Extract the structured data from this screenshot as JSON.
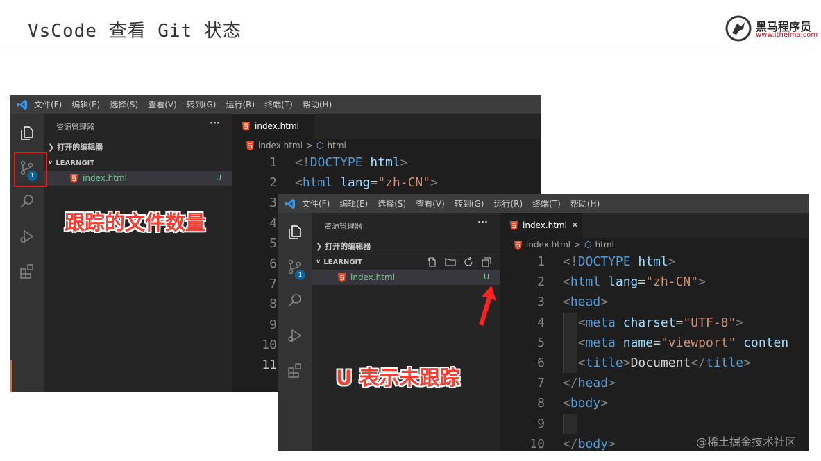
{
  "slide": {
    "title": "VsCode 查看 Git 状态",
    "logo_text": "黑马程序员",
    "logo_url": "www.itheima.com"
  },
  "menu": [
    "文件(F)",
    "编辑(E)",
    "选择(S)",
    "查看(V)",
    "转到(G)",
    "运行(R)",
    "终端(T)",
    "帮助(H)"
  ],
  "explorer": {
    "title": "资源管理器",
    "more": "···",
    "open_editors": "打开的编辑器",
    "folder": "LEARNGIT",
    "file_name": "index.html",
    "file_status": "U"
  },
  "scm_badge": "1",
  "tab": {
    "label": "index.html",
    "close": "✕"
  },
  "breadcrumb": {
    "file": "index.html",
    "sep": ">",
    "symbol": "html"
  },
  "line_numbers": [
    "1",
    "2",
    "3",
    "4",
    "5",
    "6",
    "7",
    "8",
    "9",
    "10",
    "11"
  ],
  "code_lines": [
    {
      "n": "1",
      "text": "<!DOCTYPE html>"
    },
    {
      "n": "2",
      "text": "<html lang=\"zh-CN\">"
    },
    {
      "n": "3",
      "text": "<head>"
    },
    {
      "n": "4",
      "text": "  <meta charset=\"UTF-8\">"
    },
    {
      "n": "5",
      "text": "  <meta name=\"viewport\" content"
    },
    {
      "n": "6",
      "text": "  <title>Document</title>"
    },
    {
      "n": "7",
      "text": "</head>"
    },
    {
      "n": "8",
      "text": "<body>"
    },
    {
      "n": "9",
      "text": ""
    },
    {
      "n": "10",
      "text": "</body>"
    }
  ],
  "callouts": {
    "tracked_count": "跟踪的文件数量",
    "untracked": "U 表示未跟踪"
  },
  "watermark": "@稀土掘金技术社区",
  "colors": {
    "accent_red": "#ff3b2f",
    "git_untracked": "#73c991",
    "badge_blue": "#0e639c"
  }
}
